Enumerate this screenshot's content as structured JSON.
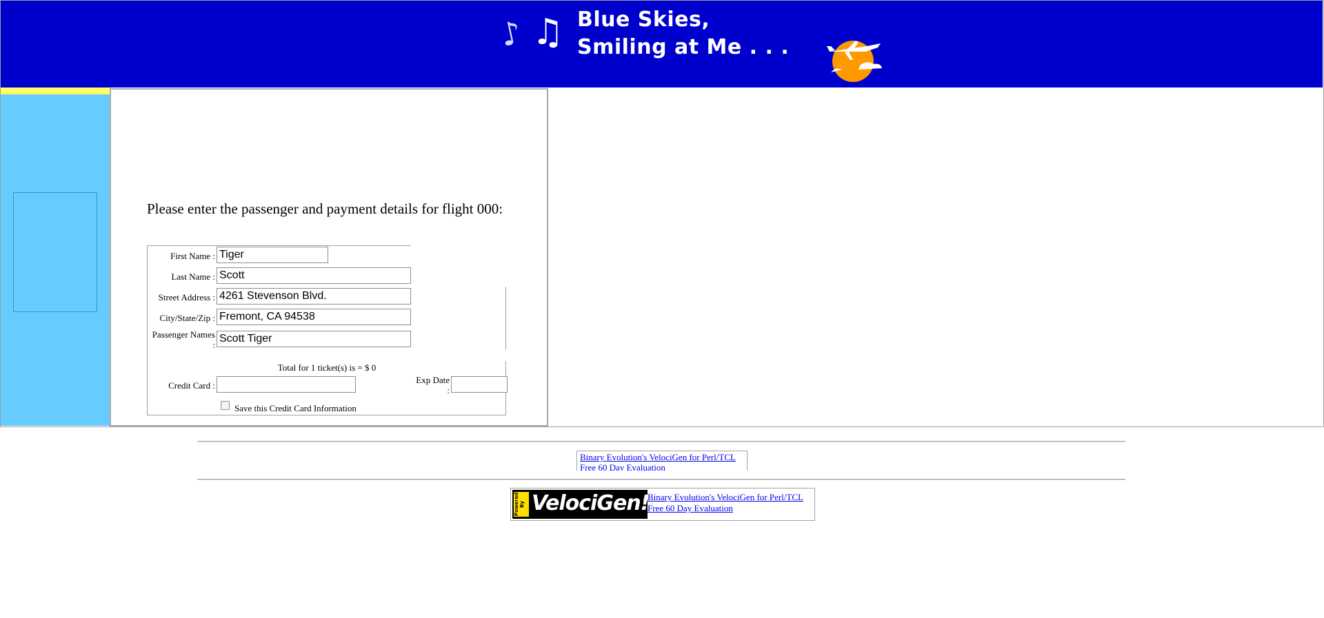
{
  "banner": {
    "title_line1": "Blue Skies,",
    "title_line2": "Smiling at Me . . .",
    "notes_icon": "music-notes-icon",
    "logo_icon": "sun-airplane-icon",
    "background_color": "#0000cc"
  },
  "sidebar": {
    "background_color": "#66ccff"
  },
  "form": {
    "intro": "Please enter the passenger and payment details for flight 000:",
    "first_name": {
      "label": "First Name :",
      "value": "Tiger"
    },
    "last_name": {
      "label": "Last Name :",
      "value": "Scott"
    },
    "street_address": {
      "label": "Street Address :",
      "value": "4261 Stevenson Blvd."
    },
    "city_state_zip": {
      "label": "City/State/Zip :",
      "value": "Fremont, CA 94538"
    },
    "passenger_names": {
      "label_line1": "Passenger Names",
      "label_line2": ":",
      "value": "Scott Tiger"
    },
    "total": "Total for 1 ticket(s) is = $ 0",
    "credit_card": {
      "label": "Credit Card :",
      "value": ""
    },
    "exp_date": {
      "label_line1": "Exp Date",
      "label_line2": ":",
      "value": ""
    },
    "save_card": {
      "label": "Save this Credit Card Information",
      "checked": false
    }
  },
  "footer": {
    "ad1": {
      "link1": "Binary Evolution's VelociGen for Perl/TCL",
      "link2": "Free 60 Day Evaluation"
    },
    "ad2": {
      "logo_text": "VelociGen!",
      "badge_text": "Powered By",
      "link1": "Binary Evolution's VelociGen for Perl/TCL",
      "link2": "Free 60 Day Evaluation"
    }
  }
}
